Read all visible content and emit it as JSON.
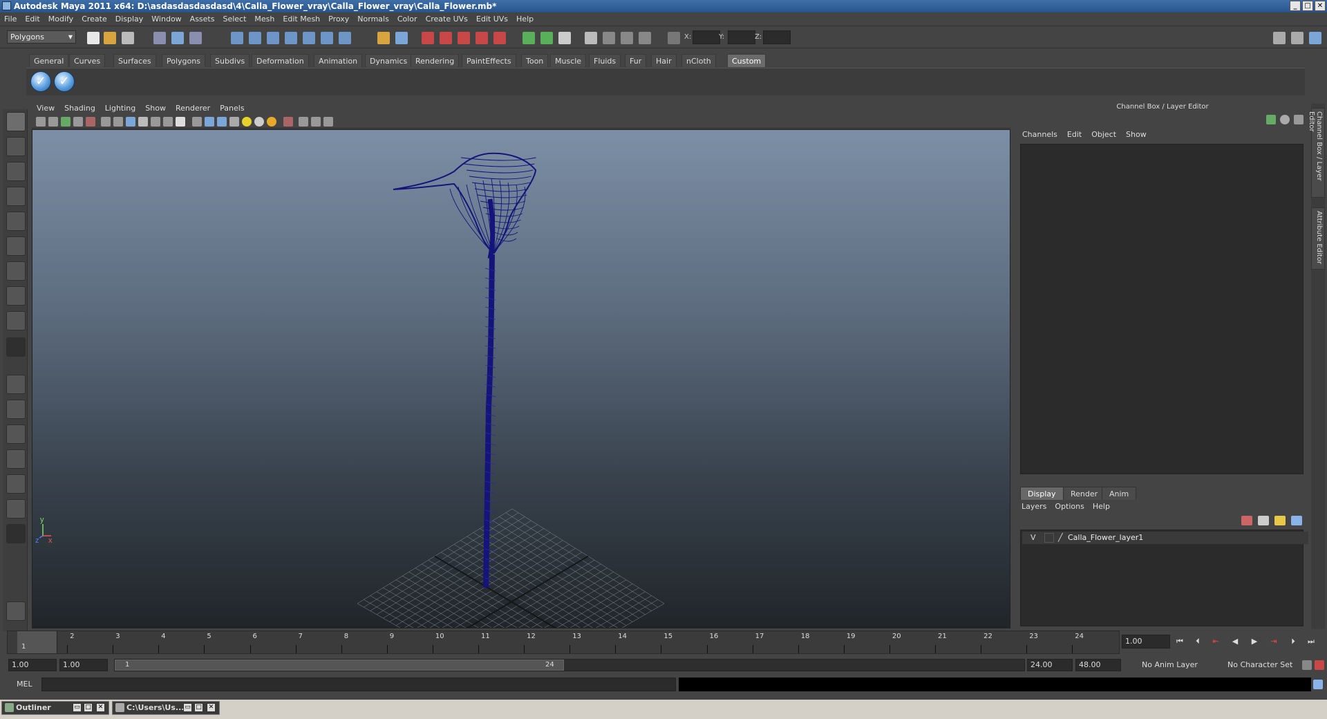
{
  "window": {
    "title": "Autodesk Maya 2011 x64: D:\\asdasdasdasdasd\\4\\Calla_Flower_vray\\Calla_Flower_vray\\Calla_Flower.mb*"
  },
  "menubar": [
    "File",
    "Edit",
    "Modify",
    "Create",
    "Display",
    "Window",
    "Assets",
    "Select",
    "Mesh",
    "Edit Mesh",
    "Proxy",
    "Normals",
    "Color",
    "Create UVs",
    "Edit UVs",
    "Help"
  ],
  "statusline": {
    "mode": "Polygons",
    "x_label": "X:",
    "y_label": "Y:",
    "z_label": "Z:"
  },
  "shelf_tabs": [
    "General",
    "Curves",
    "Surfaces",
    "Polygons",
    "Subdivs",
    "Deformation",
    "Animation",
    "Dynamics",
    "Rendering",
    "PaintEffects",
    "Toon",
    "Muscle",
    "Fluids",
    "Fur",
    "Hair",
    "nCloth",
    "Custom"
  ],
  "active_shelf_tab": "Custom",
  "viewport": {
    "menu": [
      "View",
      "Shading",
      "Lighting",
      "Show",
      "Renderer",
      "Panels"
    ],
    "axis_x": "x",
    "axis_y": "y",
    "axis_z": "z",
    "wireframe_color": "#14147a"
  },
  "channel_box": {
    "title": "Channel Box / Layer Editor",
    "menu": [
      "Channels",
      "Edit",
      "Object",
      "Show"
    ]
  },
  "layer_editor": {
    "tabs": [
      "Display",
      "Render",
      "Anim"
    ],
    "active_tab": "Display",
    "menu": [
      "Layers",
      "Options",
      "Help"
    ],
    "layers": [
      {
        "visible": "V",
        "name": "Calla_Flower_layer1"
      }
    ]
  },
  "side_tabs": [
    "Channel Box / Layer Editor",
    "Attribute Editor"
  ],
  "timeline": {
    "ticks": [
      "1",
      "2",
      "3",
      "4",
      "5",
      "6",
      "7",
      "8",
      "9",
      "10",
      "11",
      "12",
      "13",
      "14",
      "15",
      "16",
      "17",
      "18",
      "19",
      "20",
      "21",
      "22",
      "23",
      "24"
    ],
    "current_marker": "1",
    "current_frame": "1.00"
  },
  "range": {
    "start_time": "1.00",
    "playback_start": "1.00",
    "slider_start": "1",
    "slider_end": "24",
    "playback_end": "24.00",
    "end_time": "48.00",
    "anim_layer": "No Anim Layer",
    "character_set": "No Character Set"
  },
  "command_line": {
    "label": "MEL"
  },
  "taskbar": [
    {
      "label": "Outliner"
    },
    {
      "label": "C:\\Users\\Us..."
    }
  ]
}
